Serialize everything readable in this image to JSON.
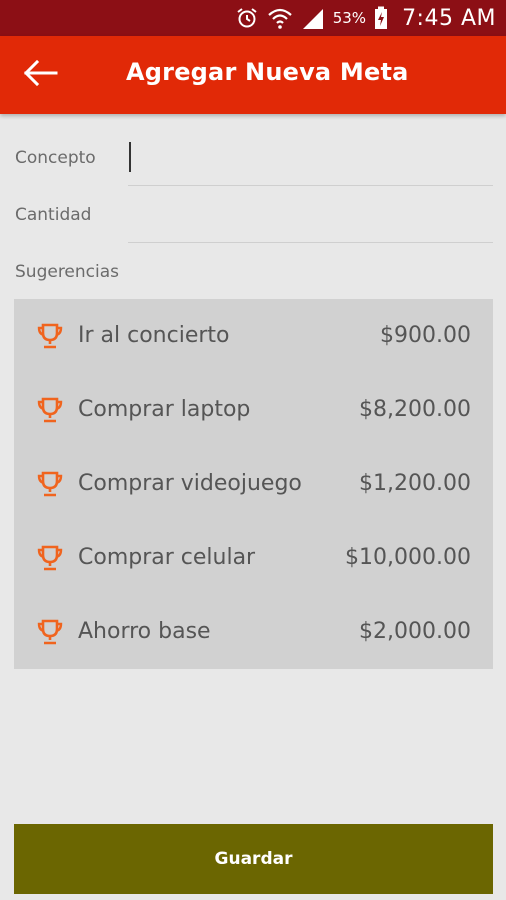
{
  "status_bar": {
    "battery_percent": "53%",
    "time": "7:45 AM",
    "icons": [
      "alarm-icon",
      "wifi-icon",
      "signal-icon",
      "battery-charging-icon"
    ],
    "background": "#8c0f15"
  },
  "app_bar": {
    "title": "Agregar Nueva Meta",
    "back_icon": "arrow-back-icon",
    "background": "#e12907"
  },
  "form": {
    "concepto_label": "Concepto",
    "concepto_value": "",
    "cantidad_label": "Cantidad",
    "cantidad_value": ""
  },
  "suggestions": {
    "label": "Sugerencias",
    "icon": "trophy-icon",
    "accent": "#f0641e",
    "items": [
      {
        "name": "Ir al concierto",
        "amount": "$900.00"
      },
      {
        "name": "Comprar laptop",
        "amount": "$8,200.00"
      },
      {
        "name": "Comprar videojuego",
        "amount": "$1,200.00"
      },
      {
        "name": "Comprar celular",
        "amount": "$10,000.00"
      },
      {
        "name": "Ahorro base",
        "amount": "$2,000.00"
      }
    ]
  },
  "save_button": {
    "label": "Guardar",
    "background": "#6b6601"
  }
}
